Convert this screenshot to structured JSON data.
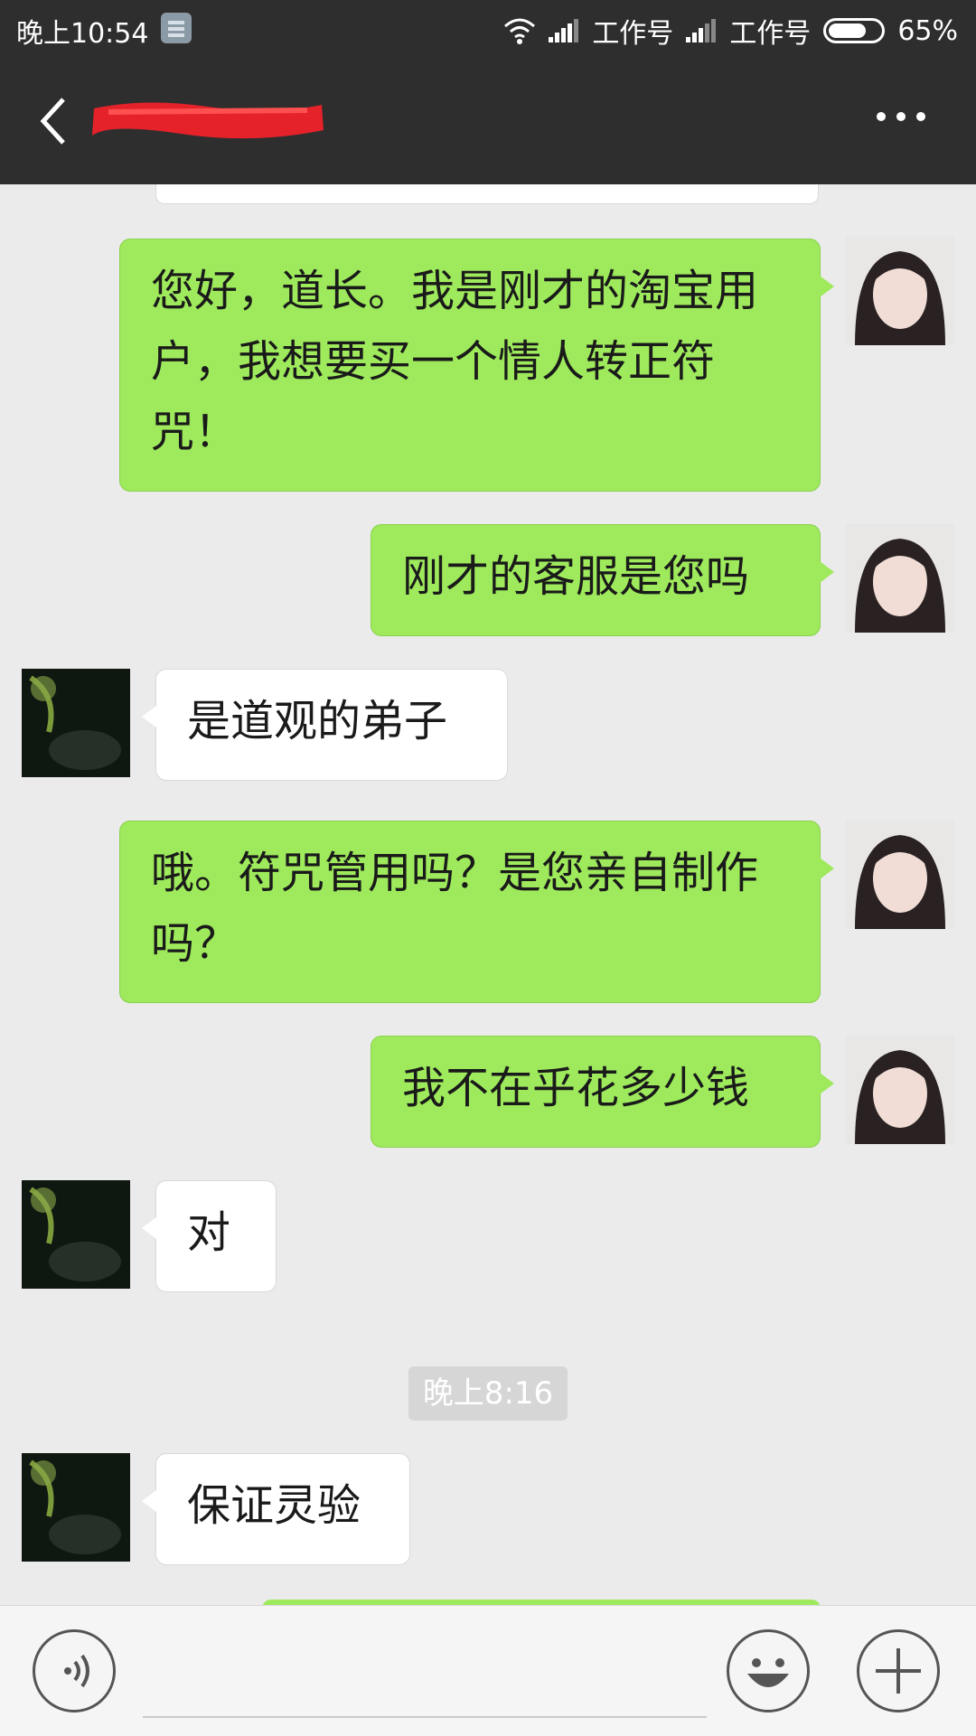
{
  "status_bar": {
    "time": "晚上10:54",
    "carrier1": "工作号",
    "carrier2": "工作号",
    "battery": "65%",
    "battery_level": 0.65
  },
  "header": {
    "contact_name_redacted": true
  },
  "messages": [
    {
      "side": "me",
      "text": "您好，道长。我是刚才的淘宝用户，我想要买一个情人转正符咒！"
    },
    {
      "side": "me",
      "text": "刚才的客服是您吗"
    },
    {
      "side": "other",
      "text": "是道观的弟子"
    },
    {
      "side": "me",
      "text": "哦。符咒管用吗？是您亲自制作吗？"
    },
    {
      "side": "me",
      "text": "我不在乎花多少钱"
    },
    {
      "side": "other",
      "text": "对"
    },
    {
      "side": "other",
      "text": "保证灵验"
    }
  ],
  "timestamp": "晚上8:16",
  "input": {
    "placeholder": ""
  },
  "colors": {
    "bar_bg": "#2e2e2e",
    "chat_bg": "#ebebeb",
    "my_bubble": "#9eea5c",
    "other_bubble": "#ffffff"
  }
}
